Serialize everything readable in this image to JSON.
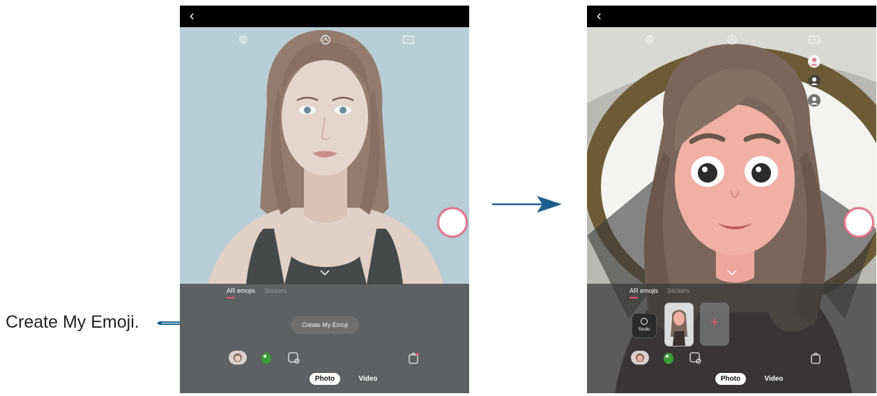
{
  "callout": {
    "label": "Create My Emoji."
  },
  "left_screen": {
    "tabs": [
      "AR emojis",
      "Stickers"
    ],
    "create_button": "Create My Emoji",
    "modes": [
      "Photo",
      "Video"
    ]
  },
  "right_screen": {
    "tabs": [
      "AR emojis",
      "Stickers"
    ],
    "studio_label": "Studio",
    "add_label": "+",
    "modes": [
      "Photo",
      "Video"
    ]
  },
  "colors": {
    "accent": "#f0506e",
    "arrow": "#1a5f8f",
    "shutter_ring": "#e4788f"
  }
}
